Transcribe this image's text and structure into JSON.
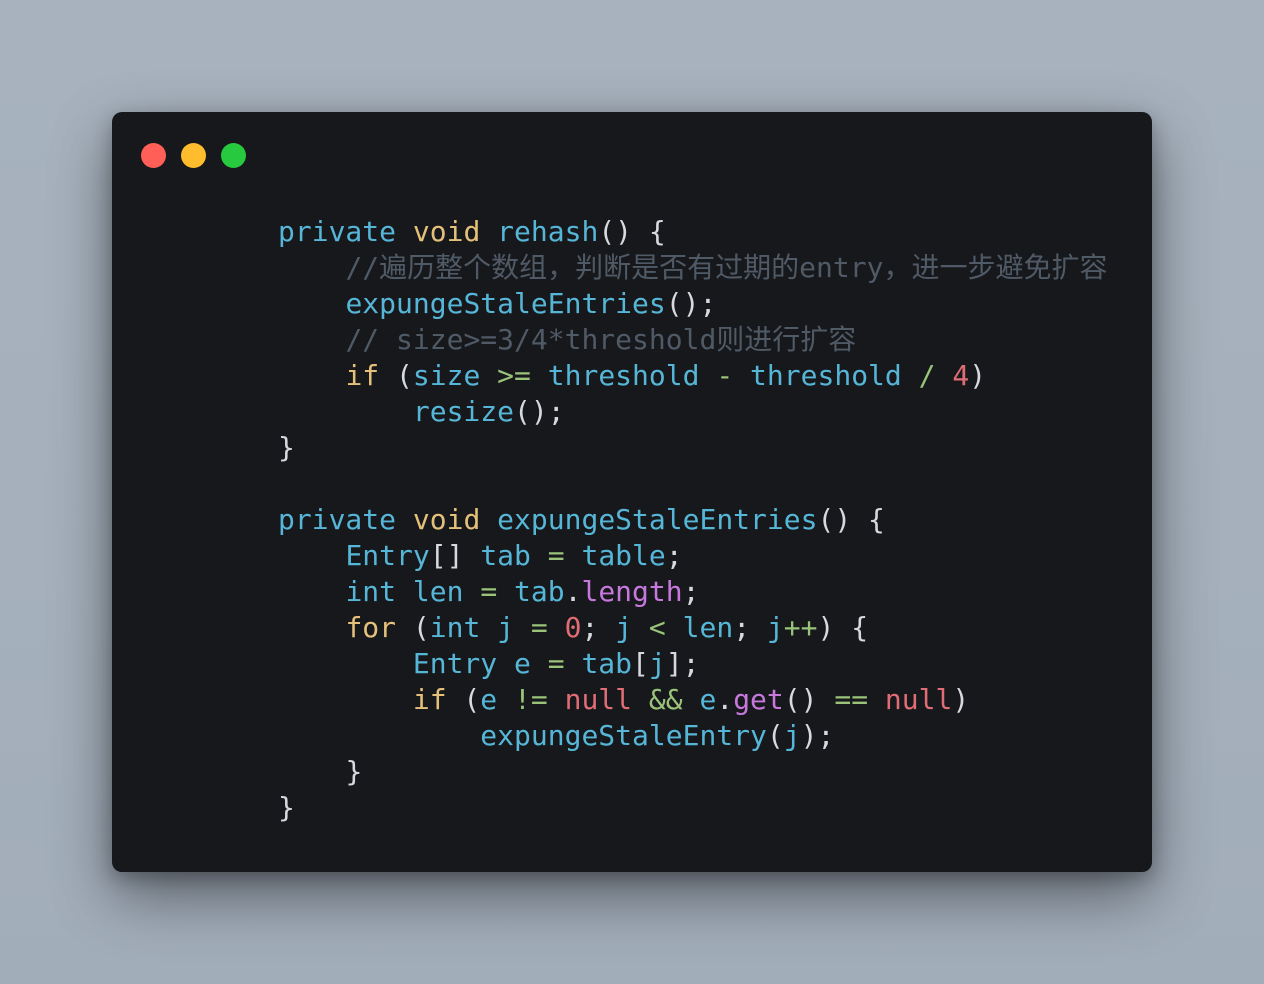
{
  "window": {
    "background": "#17181b",
    "controls": [
      {
        "name": "close-button",
        "color": "#ff5f56"
      },
      {
        "name": "minimize-button",
        "color": "#ffbd2e"
      },
      {
        "name": "maximize-button",
        "color": "#27c93f"
      }
    ]
  },
  "palette": {
    "keyword": "#56b6d7",
    "type": "#e5c07b",
    "control": "#e5c07b",
    "ident": "#56b6d7",
    "punct": "#d6dae0",
    "comment": "#4f5a66",
    "number": "#e06c75",
    "operator": "#98c379",
    "property": "#c678dd",
    "null": "#e06c75"
  },
  "code_lines": [
    [
      {
        "t": "private",
        "k": "keyword"
      },
      {
        "t": " "
      },
      {
        "t": "void",
        "k": "type"
      },
      {
        "t": " "
      },
      {
        "t": "rehash",
        "k": "ident"
      },
      {
        "t": "() {",
        "k": "punct"
      }
    ],
    [
      {
        "t": "    "
      },
      {
        "t": "//遍历整个数组，判断是否有过期的entry，进一步避免扩容",
        "k": "comment"
      }
    ],
    [
      {
        "t": "    "
      },
      {
        "t": "expungeStaleEntries",
        "k": "ident"
      },
      {
        "t": "();",
        "k": "punct"
      }
    ],
    [
      {
        "t": "    "
      },
      {
        "t": "// size>=3/4*threshold则进行扩容",
        "k": "comment"
      }
    ],
    [
      {
        "t": "    "
      },
      {
        "t": "if",
        "k": "control"
      },
      {
        "t": " (",
        "k": "punct"
      },
      {
        "t": "size",
        "k": "ident"
      },
      {
        "t": " "
      },
      {
        "t": ">=",
        "k": "operator"
      },
      {
        "t": " "
      },
      {
        "t": "threshold",
        "k": "ident"
      },
      {
        "t": " "
      },
      {
        "t": "-",
        "k": "operator"
      },
      {
        "t": " "
      },
      {
        "t": "threshold",
        "k": "ident"
      },
      {
        "t": " "
      },
      {
        "t": "/",
        "k": "operator"
      },
      {
        "t": " "
      },
      {
        "t": "4",
        "k": "number"
      },
      {
        "t": ")",
        "k": "punct"
      }
    ],
    [
      {
        "t": "        "
      },
      {
        "t": "resize",
        "k": "ident"
      },
      {
        "t": "();",
        "k": "punct"
      }
    ],
    [
      {
        "t": "}",
        "k": "punct"
      }
    ],
    [],
    [
      {
        "t": "private",
        "k": "keyword"
      },
      {
        "t": " "
      },
      {
        "t": "void",
        "k": "type"
      },
      {
        "t": " "
      },
      {
        "t": "expungeStaleEntries",
        "k": "ident"
      },
      {
        "t": "() {",
        "k": "punct"
      }
    ],
    [
      {
        "t": "    "
      },
      {
        "t": "Entry",
        "k": "ident"
      },
      {
        "t": "[]",
        "k": "punct"
      },
      {
        "t": " "
      },
      {
        "t": "tab",
        "k": "ident"
      },
      {
        "t": " "
      },
      {
        "t": "=",
        "k": "operator"
      },
      {
        "t": " "
      },
      {
        "t": "table",
        "k": "ident"
      },
      {
        "t": ";",
        "k": "punct"
      }
    ],
    [
      {
        "t": "    "
      },
      {
        "t": "int",
        "k": "keyword"
      },
      {
        "t": " "
      },
      {
        "t": "len",
        "k": "ident"
      },
      {
        "t": " "
      },
      {
        "t": "=",
        "k": "operator"
      },
      {
        "t": " "
      },
      {
        "t": "tab",
        "k": "ident"
      },
      {
        "t": ".",
        "k": "punct"
      },
      {
        "t": "length",
        "k": "property"
      },
      {
        "t": ";",
        "k": "punct"
      }
    ],
    [
      {
        "t": "    "
      },
      {
        "t": "for",
        "k": "control"
      },
      {
        "t": " (",
        "k": "punct"
      },
      {
        "t": "int",
        "k": "keyword"
      },
      {
        "t": " "
      },
      {
        "t": "j",
        "k": "ident"
      },
      {
        "t": " "
      },
      {
        "t": "=",
        "k": "operator"
      },
      {
        "t": " "
      },
      {
        "t": "0",
        "k": "number"
      },
      {
        "t": "; ",
        "k": "punct"
      },
      {
        "t": "j",
        "k": "ident"
      },
      {
        "t": " "
      },
      {
        "t": "<",
        "k": "operator"
      },
      {
        "t": " "
      },
      {
        "t": "len",
        "k": "ident"
      },
      {
        "t": "; ",
        "k": "punct"
      },
      {
        "t": "j",
        "k": "ident"
      },
      {
        "t": "++",
        "k": "operator"
      },
      {
        "t": ") {",
        "k": "punct"
      }
    ],
    [
      {
        "t": "        "
      },
      {
        "t": "Entry",
        "k": "ident"
      },
      {
        "t": " "
      },
      {
        "t": "e",
        "k": "ident"
      },
      {
        "t": " "
      },
      {
        "t": "=",
        "k": "operator"
      },
      {
        "t": " "
      },
      {
        "t": "tab",
        "k": "ident"
      },
      {
        "t": "[",
        "k": "punct"
      },
      {
        "t": "j",
        "k": "ident"
      },
      {
        "t": "];",
        "k": "punct"
      }
    ],
    [
      {
        "t": "        "
      },
      {
        "t": "if",
        "k": "control"
      },
      {
        "t": " (",
        "k": "punct"
      },
      {
        "t": "e",
        "k": "ident"
      },
      {
        "t": " "
      },
      {
        "t": "!=",
        "k": "operator"
      },
      {
        "t": " "
      },
      {
        "t": "null",
        "k": "null"
      },
      {
        "t": " "
      },
      {
        "t": "&&",
        "k": "operator"
      },
      {
        "t": " "
      },
      {
        "t": "e",
        "k": "ident"
      },
      {
        "t": ".",
        "k": "punct"
      },
      {
        "t": "get",
        "k": "property"
      },
      {
        "t": "() ",
        "k": "punct"
      },
      {
        "t": "==",
        "k": "operator"
      },
      {
        "t": " "
      },
      {
        "t": "null",
        "k": "null"
      },
      {
        "t": ")",
        "k": "punct"
      }
    ],
    [
      {
        "t": "            "
      },
      {
        "t": "expungeStaleEntry",
        "k": "ident"
      },
      {
        "t": "(",
        "k": "punct"
      },
      {
        "t": "j",
        "k": "ident"
      },
      {
        "t": ");",
        "k": "punct"
      }
    ],
    [
      {
        "t": "    "
      },
      {
        "t": "}",
        "k": "punct"
      }
    ],
    [
      {
        "t": "}",
        "k": "punct"
      }
    ]
  ]
}
